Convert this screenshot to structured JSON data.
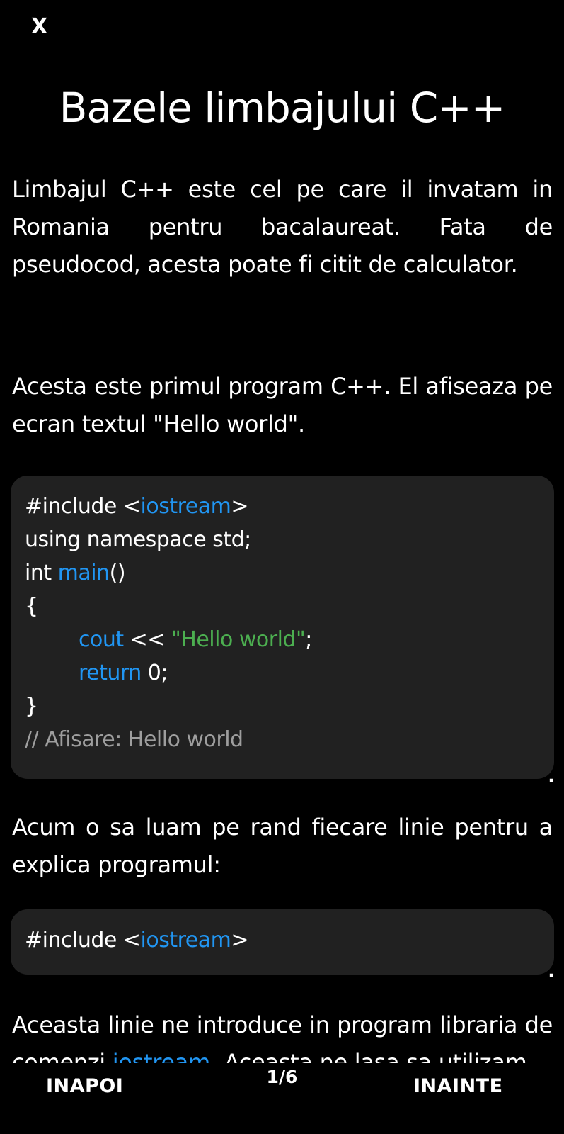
{
  "header": {
    "close_label": "X"
  },
  "lesson": {
    "title": "Bazele limbajului C++",
    "intro": "Limbajul C++ este cel pe care il invatam in Romania pentru bacalaureat. Fata de pseudocod, acesta poate fi citit de calculator.",
    "first_program_text": "Acesta este primul program C++. El afiseaza pe ecran textul \"Hello world\".",
    "code_example": {
      "line1_prefix": "#include <",
      "line1_lib": "iostream",
      "line1_suffix": ">",
      "line2": "using namespace std;",
      "line3_type": "int ",
      "line3_func": "main",
      "line3_parens": "()",
      "line4": "{",
      "line5_cout": "cout",
      "line5_op": " << ",
      "line5_str": "\"Hello world\"",
      "line5_end": ";",
      "line6_return": "return",
      "line6_rest": " 0;",
      "line7": "}",
      "line8_comment": "// Afisare: Hello world"
    },
    "explain_text": "Acum o sa luam pe rand fiecare linie pentru a explica programul:",
    "code_snippet": {
      "prefix": "#include <",
      "lib": "iostream",
      "suffix": ">"
    },
    "include_explain_start": "Aceasta linie ne introduce in program libraria de comenzi ",
    "include_explain_link": "iostream",
    "include_explain_end": ". Aceasta ne lasa sa utilizam",
    "dot": "."
  },
  "footer": {
    "back_label": "INAPOI",
    "page_indicator": "1/6",
    "next_label": "INAINTE"
  },
  "colors": {
    "background": "#000000",
    "code_background": "#212121",
    "keyword": "#2196f3",
    "string": "#4caf50",
    "comment": "#9e9e9e"
  }
}
